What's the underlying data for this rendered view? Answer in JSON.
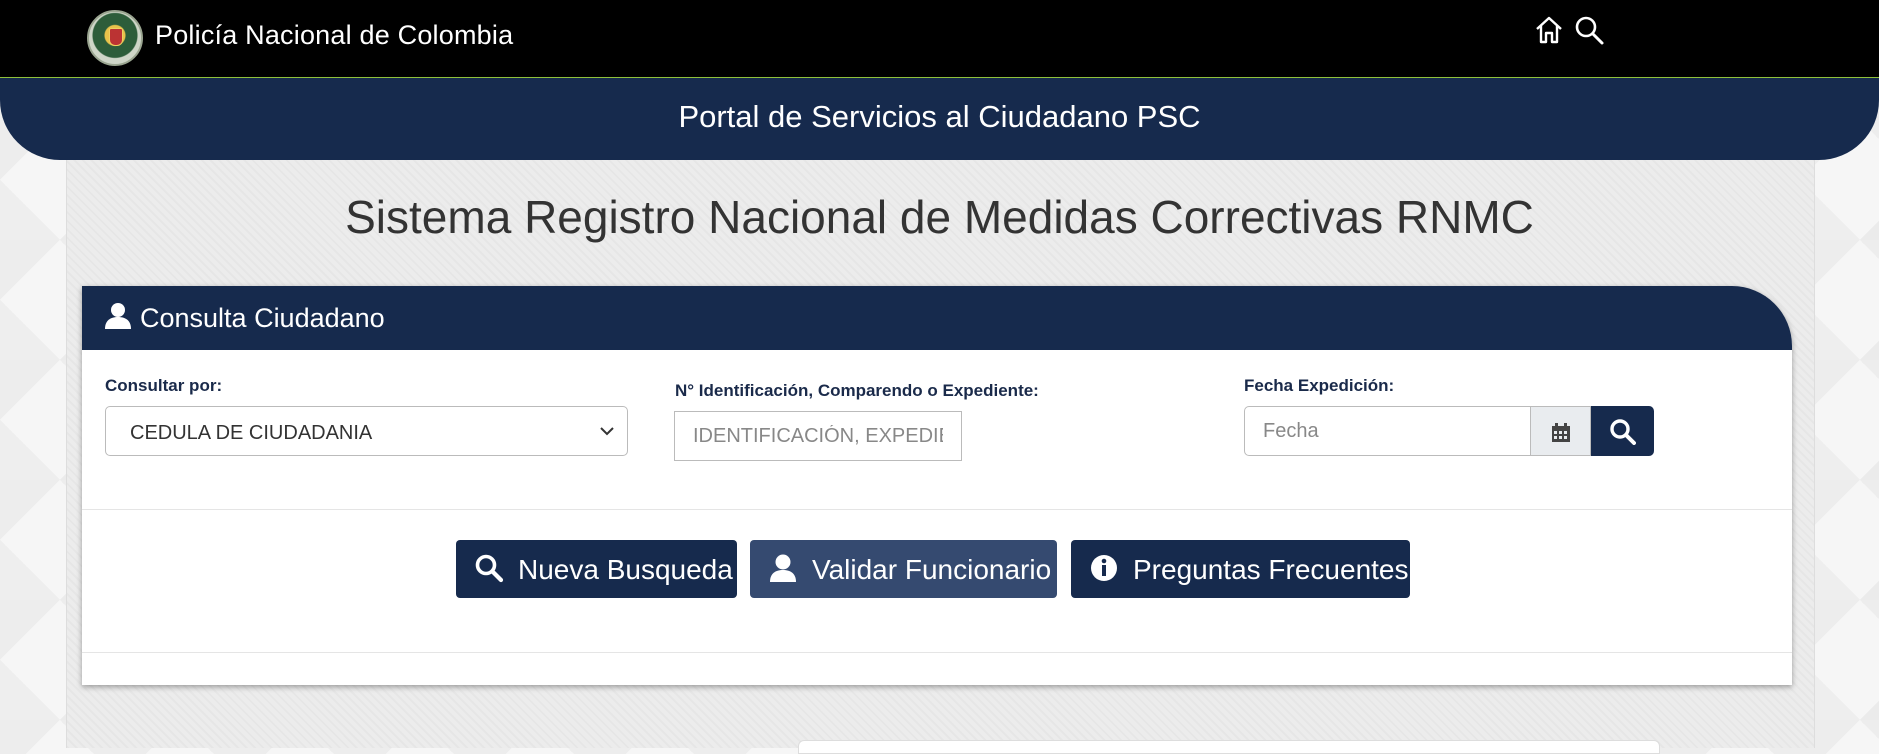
{
  "header": {
    "brand": "Policía Nacional de Colombia",
    "icons": [
      "home-icon",
      "search-icon"
    ]
  },
  "banner": {
    "title": "Portal de Servicios al Ciudadano PSC"
  },
  "page": {
    "title": "Sistema Registro Nacional de Medidas Correctivas RNMC"
  },
  "panel": {
    "title": "Consulta Ciudadano",
    "consultar_label": "Consultar por:",
    "consultar_value": "CEDULA DE CIUDADANIA",
    "id_label": "N° Identificación, Comparendo o Expediente:",
    "id_placeholder": "IDENTIFICACIÓN, EXPEDIENTE",
    "fecha_label": "Fecha Expedición:",
    "fecha_placeholder": "Fecha"
  },
  "actions": {
    "nueva": "Nueva Busqueda",
    "validar": "Validar Funcionario",
    "preguntas": "Preguntas Frecuentes"
  },
  "colors": {
    "navy": "#162a4d",
    "accent_line": "#8fc13a",
    "button_mid": "#354a70"
  }
}
